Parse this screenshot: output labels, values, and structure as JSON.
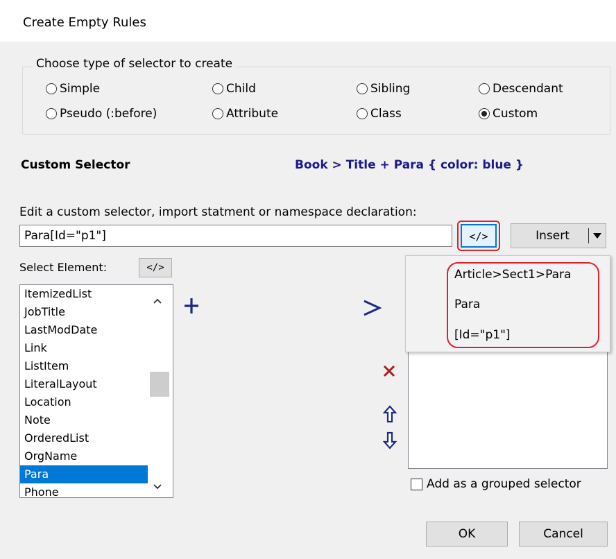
{
  "dialog": {
    "title": "Create Empty Rules"
  },
  "selector_type": {
    "legend": "Choose type of selector to create",
    "options": [
      {
        "label": "Simple",
        "checked": false
      },
      {
        "label": "Child",
        "checked": false
      },
      {
        "label": "Sibling",
        "checked": false
      },
      {
        "label": "Descendant",
        "checked": false
      },
      {
        "label": "Pseudo (:before)",
        "checked": false
      },
      {
        "label": "Attribute",
        "checked": false
      },
      {
        "label": "Class",
        "checked": false
      },
      {
        "label": "Custom",
        "checked": true
      }
    ]
  },
  "custom": {
    "heading": "Custom Selector",
    "preview": "Book > Title + Para { color: blue }",
    "edit_label": "Edit a custom selector, import statment or namespace declaration:",
    "value": "Para[Id=\"p1\"]",
    "tag_button": "</>",
    "insert_label": "Insert"
  },
  "popup": {
    "items": [
      "Article>Sect1>Para",
      "Para",
      "[Id=\"p1\"]"
    ]
  },
  "select_element": {
    "label": "Select Element:",
    "tag_button": "</>",
    "items": [
      "ItemizedList",
      "JobTitle",
      "LastModDate",
      "Link",
      "ListItem",
      "LiteralLayout",
      "Location",
      "Note",
      "OrderedList",
      "OrgName",
      "Para",
      "Phone"
    ],
    "selected": "Para"
  },
  "icons": {
    "add": "plus-icon",
    "child": "greater-than-icon",
    "remove": "x-icon",
    "up": "up-arrow-icon",
    "down": "down-arrow-icon"
  },
  "grouped": {
    "label": "Add as a grouped selector",
    "checked": false
  },
  "buttons": {
    "ok": "OK",
    "cancel": "Cancel"
  },
  "colors": {
    "accent": "#0078d7",
    "highlight": "#e0202c",
    "preview_text": "#1a1a8c"
  }
}
